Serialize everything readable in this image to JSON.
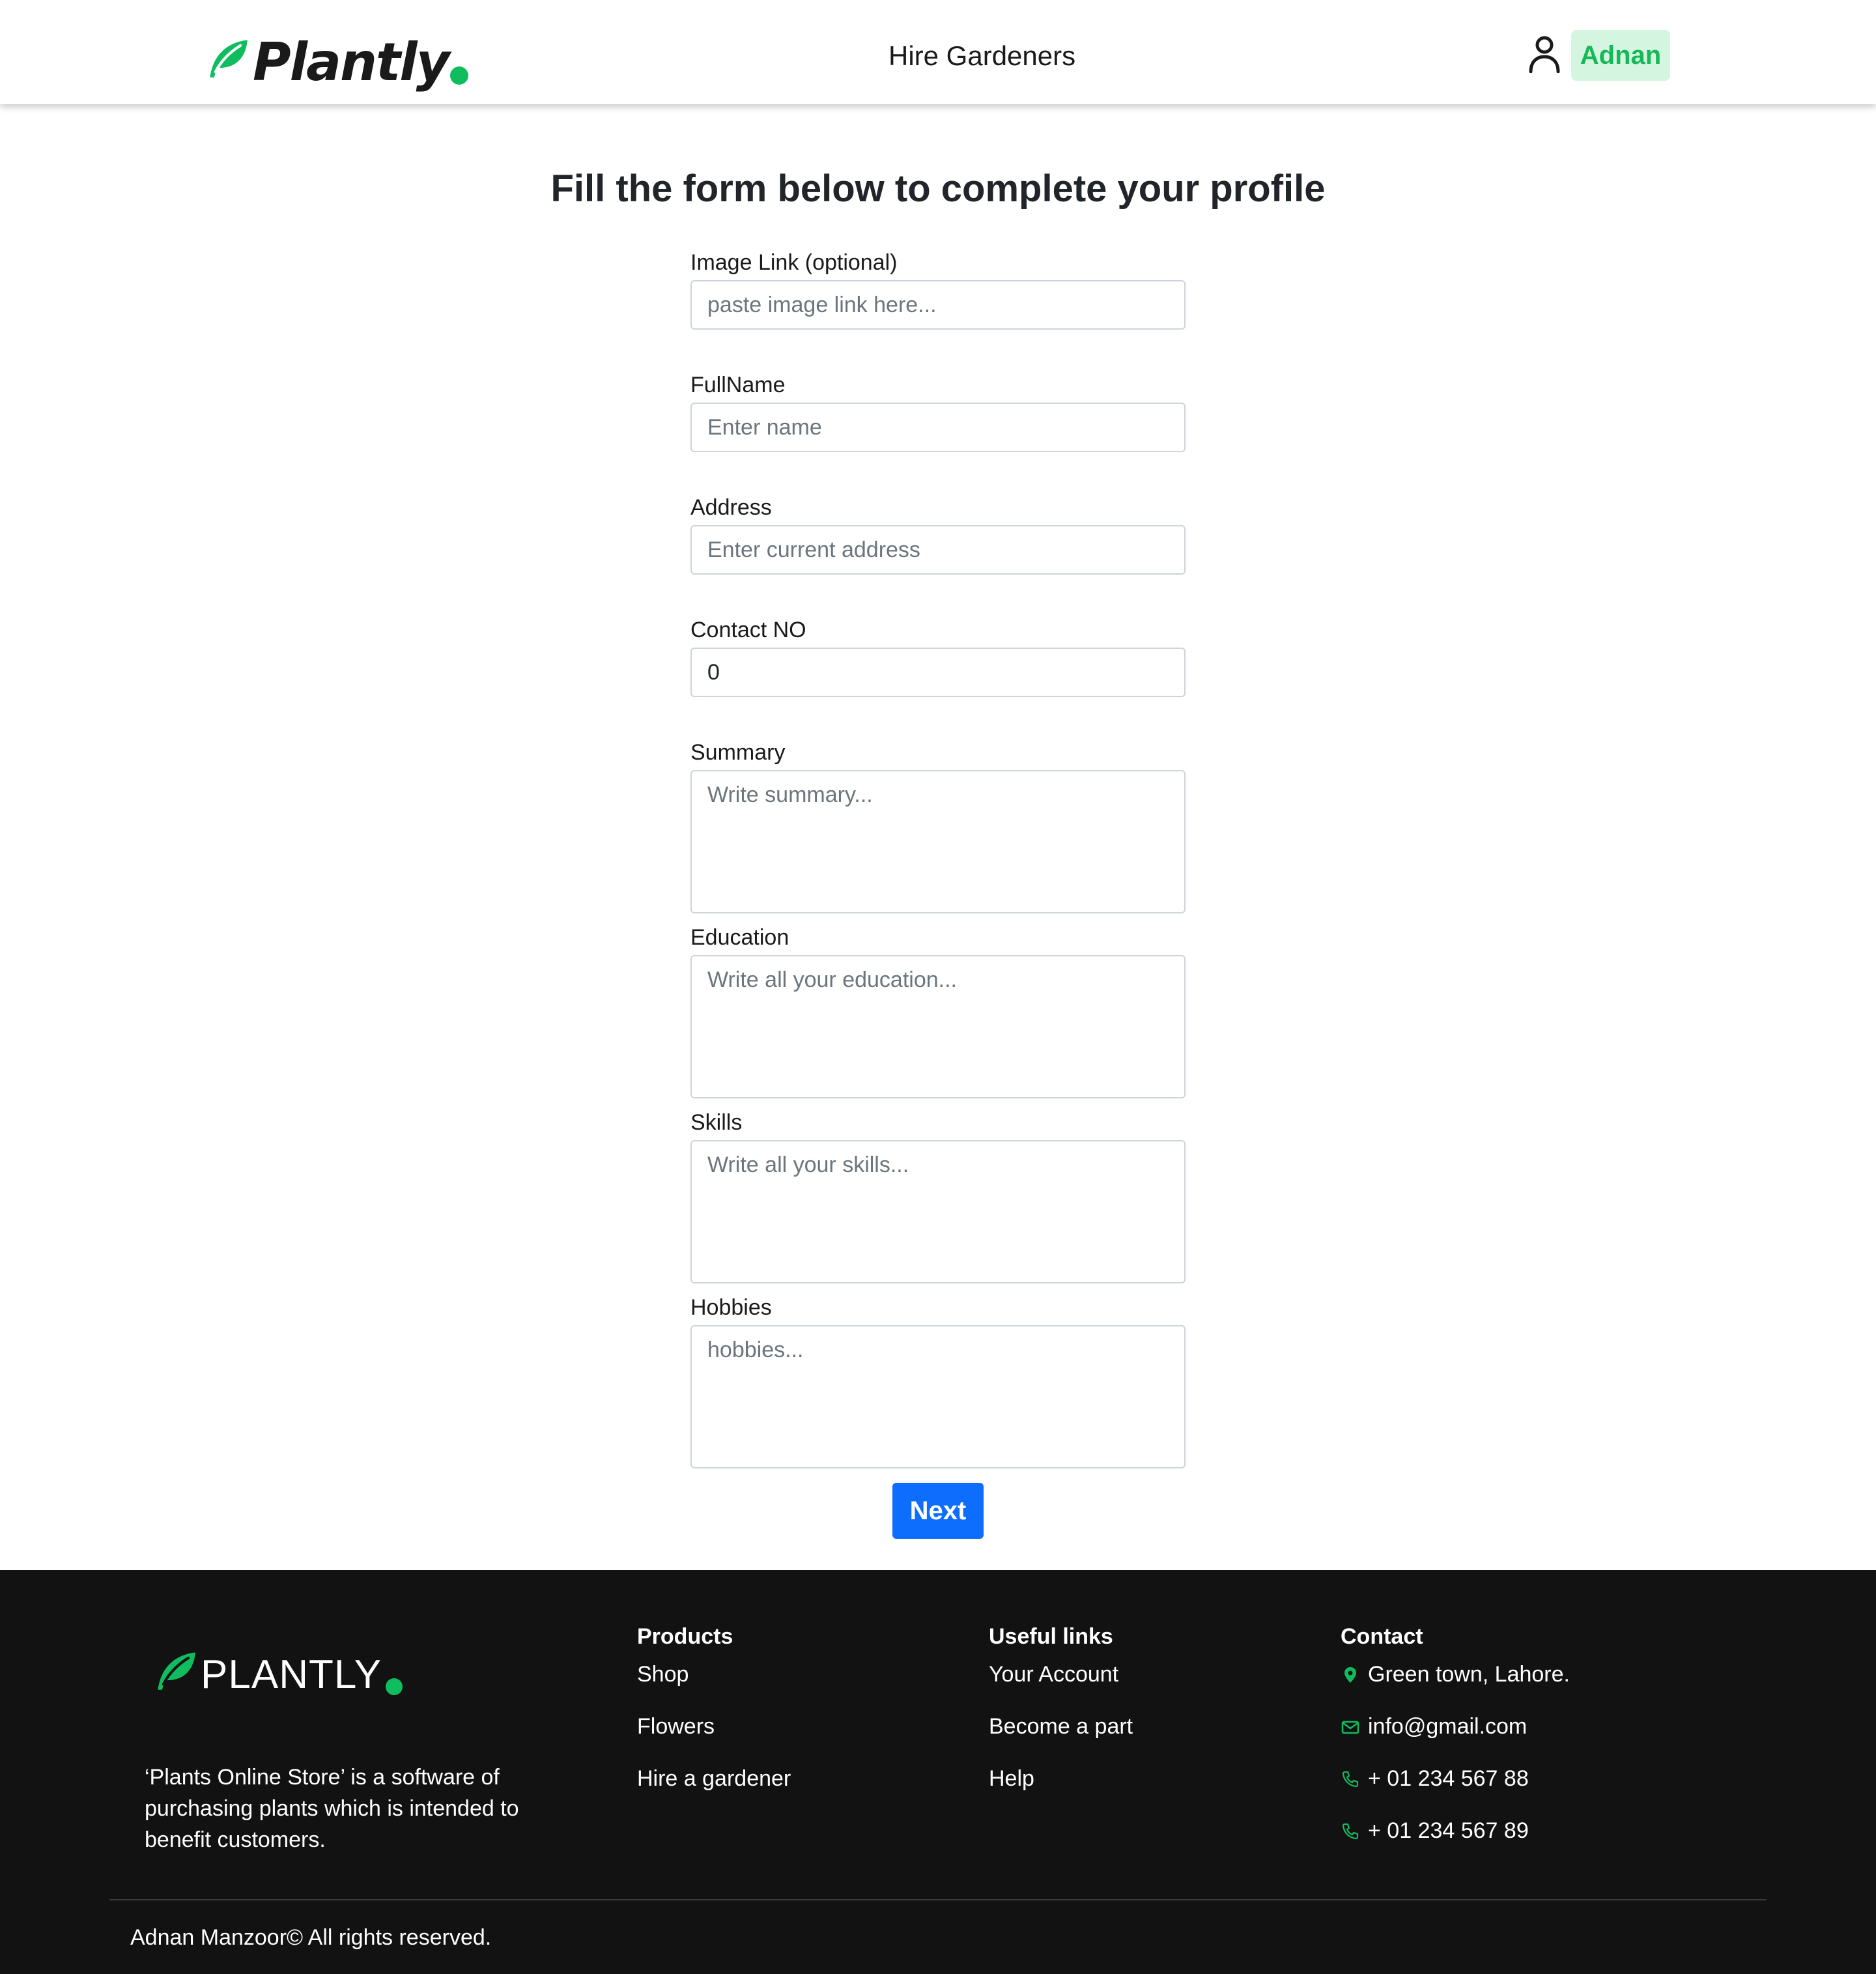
{
  "header": {
    "logo_text": "Plantly",
    "nav_link": "Hire Gardeners",
    "user_name": "Adnan"
  },
  "form": {
    "title": "Fill the form below to complete your profile",
    "image_link": {
      "label": "Image Link (optional)",
      "placeholder": "paste image link here..."
    },
    "full_name": {
      "label": "FullName",
      "placeholder": "Enter name"
    },
    "address": {
      "label": "Address",
      "placeholder": "Enter current address"
    },
    "contact": {
      "label": "Contact NO",
      "value": "0"
    },
    "summary": {
      "label": "Summary",
      "placeholder": "Write summary..."
    },
    "education": {
      "label": "Education",
      "placeholder": "Write all your education..."
    },
    "skills": {
      "label": "Skills",
      "placeholder": "Write all your skills..."
    },
    "hobbies": {
      "label": "Hobbies",
      "placeholder": "hobbies..."
    },
    "next_label": "Next"
  },
  "footer": {
    "logo_text": "PLANTLY",
    "description": "‘Plants Online Store’ is a software of purchasing plants which is intended to benefit customers.",
    "products": {
      "heading": "Products",
      "items": [
        "Shop",
        "Flowers",
        "Hire a gardener"
      ]
    },
    "useful_links": {
      "heading": "Useful links",
      "items": [
        "Your Account",
        "Become a part",
        "Help"
      ]
    },
    "contact": {
      "heading": "Contact",
      "address": "Green town, Lahore.",
      "email": "info@gmail.com",
      "phone1": "+ 01 234 567 88",
      "phone2": "+ 01 234 567 89"
    },
    "copyright": "Adnan Manzoor© All rights reserved."
  },
  "colors": {
    "brand_green": "#0fbd5e",
    "user_badge_bg": "#d4f5df",
    "primary_button": "#0d6efd",
    "footer_bg": "#121212"
  },
  "icons": [
    "leaf-icon",
    "user-icon",
    "location-pin-icon",
    "mail-icon",
    "phone-icon"
  ]
}
